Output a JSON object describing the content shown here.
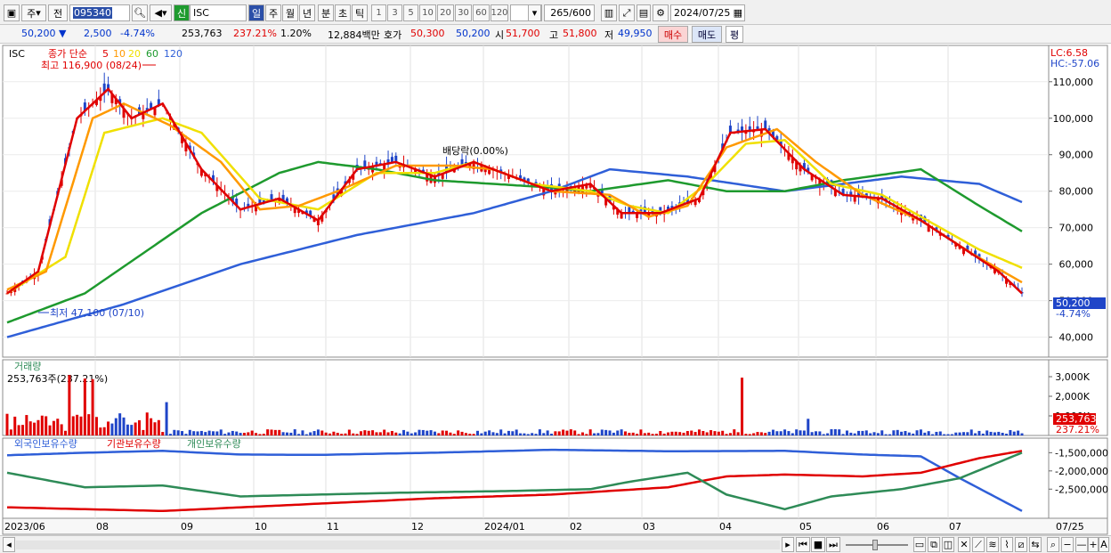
{
  "toolbar": {
    "period_stock": "주",
    "prev": "전",
    "code": "095340",
    "credit": "신",
    "name": "ISC",
    "periods": [
      "일",
      "주",
      "월",
      "년",
      "분",
      "초",
      "틱"
    ],
    "nums": [
      "1",
      "3",
      "5",
      "10",
      "20",
      "30",
      "60",
      "120"
    ],
    "count": "265",
    "total": "/600",
    "date": "2024/07/25"
  },
  "info": {
    "price": "50,200",
    "arrow": "▼",
    "change": "2,500",
    "change_pct": "-4.74%",
    "volume": "253,763",
    "vol_ratio": "237.21%",
    "turnover": "1.20%",
    "amount": "12,884백만",
    "ask_label": "호가",
    "ask": "50,300",
    "bid": "50,200",
    "open_label": "시",
    "open": "51,700",
    "high_label": "고",
    "high": "51,800",
    "low_label": "저",
    "low": "49,950",
    "buy": "매수",
    "sell": "매도",
    "eval": "평"
  },
  "chart_data": [
    {
      "type": "line",
      "title": "ISC",
      "legend_prefix": "종가 단순",
      "ma_periods": [
        "5",
        "10",
        "20",
        "60",
        "120"
      ],
      "colors": {
        "ma5": "#e00000",
        "ma10": "#ff9900",
        "ma20": "#f0e000",
        "ma60": "#1e9a2e",
        "ma120": "#2f5fd8"
      },
      "x_ticks": [
        "2023/06",
        "08",
        "09",
        "10",
        "11",
        "12",
        "2024/01",
        "02",
        "03",
        "04",
        "05",
        "06",
        "07",
        "07/25"
      ],
      "y_ticks": [
        "110,000",
        "100,000",
        "90,000",
        "80,000",
        "70,000",
        "60,000",
        "50,000",
        "40,000"
      ],
      "ylim": [
        36000,
        118000
      ],
      "annotations": {
        "high": "최고 116,900 (08/24)",
        "low": "최저 47,100 (07/10)",
        "dividend": "배당락(0.00%)",
        "lc": "LC:6.58",
        "hc": "HC:-57.06",
        "last_price": "50,200",
        "last_pct": "-4.74%"
      }
    },
    {
      "type": "bar",
      "title": "거래량",
      "value_label": "253,763주(237.21%)",
      "y_ticks": [
        "3,000K",
        "2,000K",
        "1,000K"
      ],
      "ylim": [
        0,
        3500
      ],
      "last_value": "253,763",
      "last_pct": "237.21%"
    },
    {
      "type": "line",
      "legend": [
        "외국인보유수량",
        "기관보유수량",
        "개인보유수량"
      ],
      "colors": [
        "#2f5fd8",
        "#e00000",
        "#2e8b57"
      ],
      "y_ticks": [
        "-1,500,000",
        "-2,000,000",
        "-2,500,000"
      ],
      "ylim": [
        -3300000,
        -1100000
      ]
    }
  ]
}
